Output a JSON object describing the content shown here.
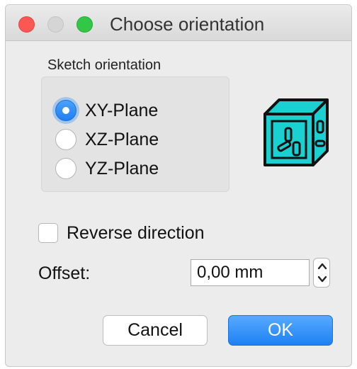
{
  "window": {
    "title": "Choose orientation"
  },
  "sketch_orientation": {
    "label": "Sketch orientation",
    "options": [
      {
        "label": "XY-Plane",
        "selected": true
      },
      {
        "label": "XZ-Plane",
        "selected": false
      },
      {
        "label": "YZ-Plane",
        "selected": false
      }
    ],
    "icon": "cube-orientation-icon"
  },
  "reverse_direction": {
    "label": "Reverse direction",
    "checked": false
  },
  "offset": {
    "label": "Offset:",
    "value": "0,00 mm"
  },
  "buttons": {
    "cancel": "Cancel",
    "ok": "OK"
  },
  "colors": {
    "accent": "#1d81f3",
    "cube": "#1ad0d0",
    "close": "#fc5753",
    "maximize": "#33c748"
  }
}
